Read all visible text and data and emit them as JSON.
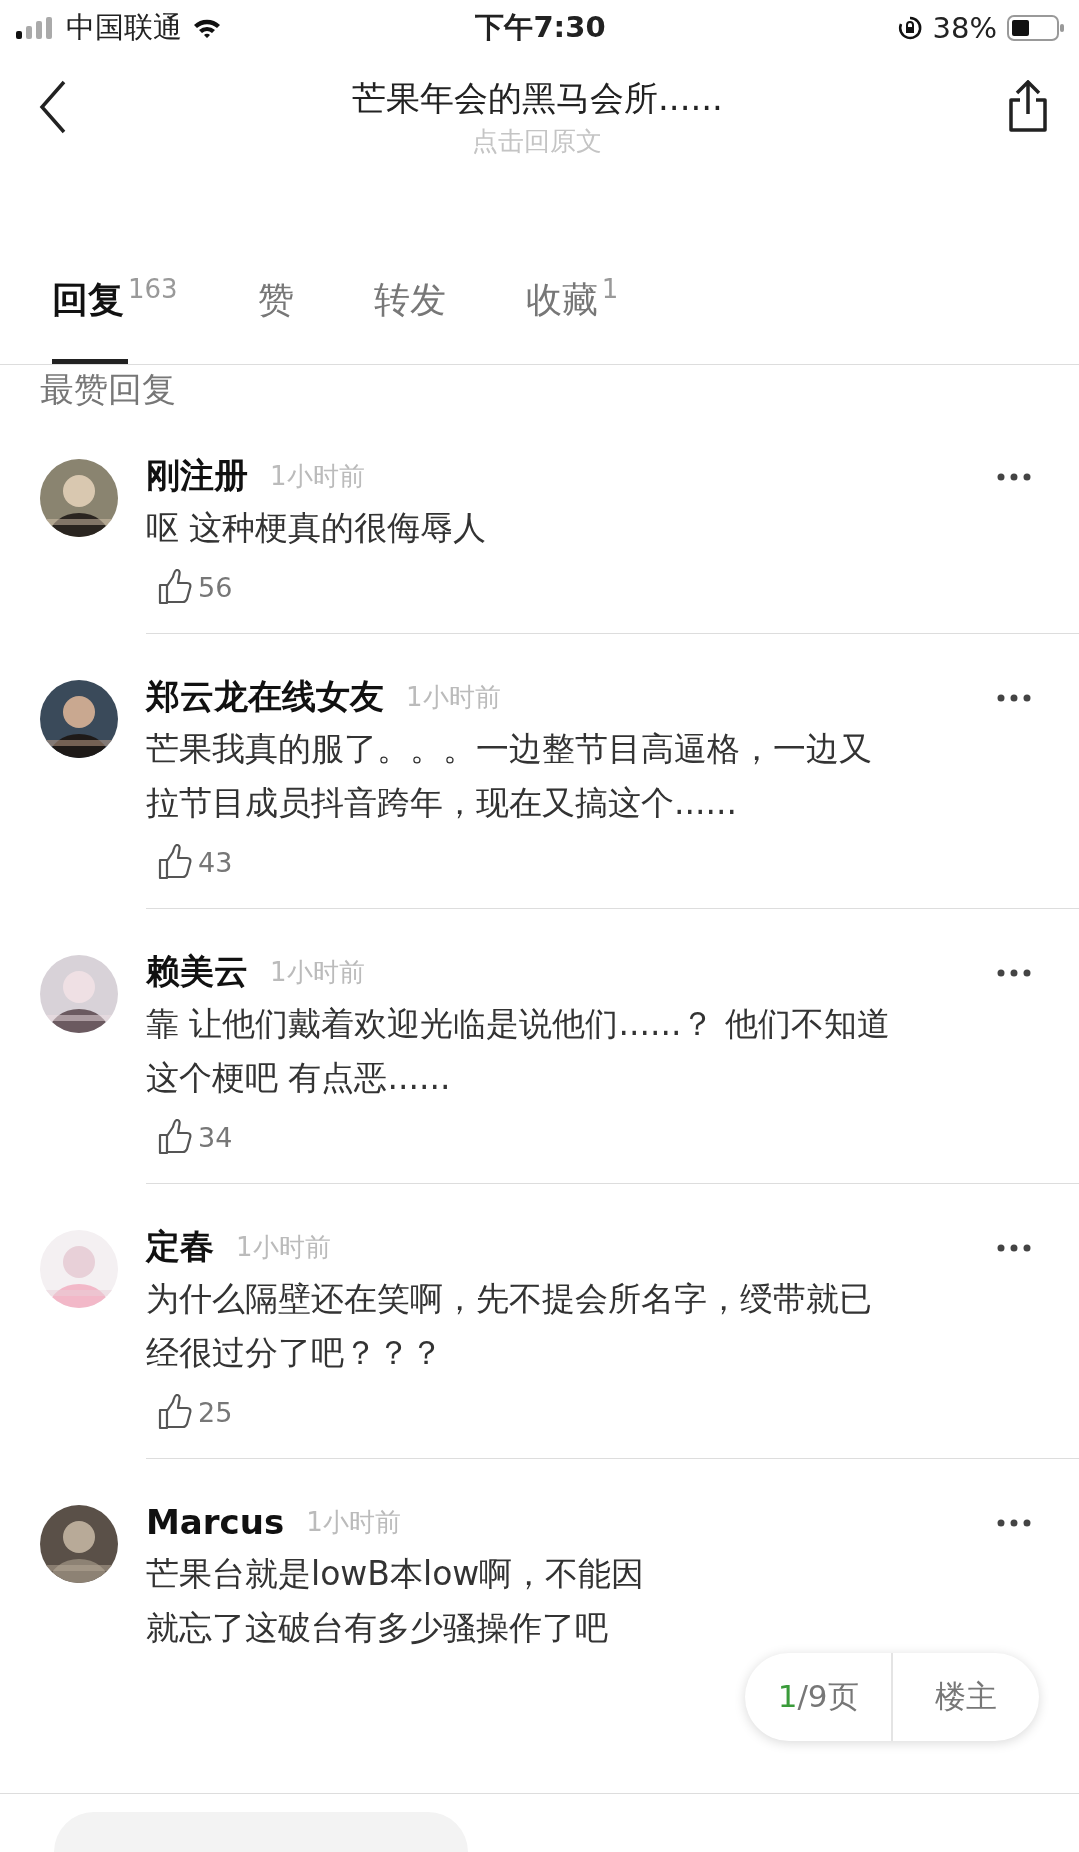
{
  "status_bar": {
    "carrier": "中国联通",
    "time": "下午7:30",
    "battery": "38%"
  },
  "header": {
    "title": "芒果年会的黑马会所......",
    "subtitle": "点击回原文"
  },
  "tabs": [
    {
      "label": "回复",
      "count": "163",
      "selected": true
    },
    {
      "label": "赞",
      "selected": false
    },
    {
      "label": "转发",
      "selected": false
    },
    {
      "label": "收藏",
      "count": "1",
      "selected": false
    }
  ],
  "section_title": "最赞回复",
  "comments": [
    {
      "avatar": {
        "kind": "picture"
      },
      "name": "刚注册",
      "time": "1小时前",
      "lines": [
        "呕 这种梗真的很侮辱人"
      ],
      "likes": "56"
    },
    {
      "avatar": {
        "kind": "picture"
      },
      "name": "郑云龙在线女友",
      "time": "1小时前",
      "lines": [
        "芒果我真的服了。。。一边整节目高逼格，一边又",
        "拉节目成员抖音跨年，现在又搞这个......"
      ],
      "likes": "43"
    },
    {
      "avatar": {
        "kind": "picture"
      },
      "name": "赖美云",
      "time": "1小时前",
      "lines": [
        "靠 让他们戴着欢迎光临是说他们......？ 他们不知道",
        "这个梗吧 有点恶......"
      ],
      "likes": "34"
    },
    {
      "avatar": {
        "kind": "picture"
      },
      "name": "定春",
      "time": "1小时前",
      "lines": [
        "为什么隔壁还在笑啊，先不提会所名字，绶带就已",
        "经很过分了吧？？？"
      ],
      "likes": "25"
    },
    {
      "avatar": {
        "kind": "picture"
      },
      "name": "Marcus",
      "time": "1小时前",
      "lines": [
        "芒果台就是lowB本low啊，不能因",
        "就忘了这破台有多少骚操作了吧"
      ]
    }
  ],
  "pager": {
    "current": "1",
    "total": "/9页",
    "owner": "楼主"
  }
}
